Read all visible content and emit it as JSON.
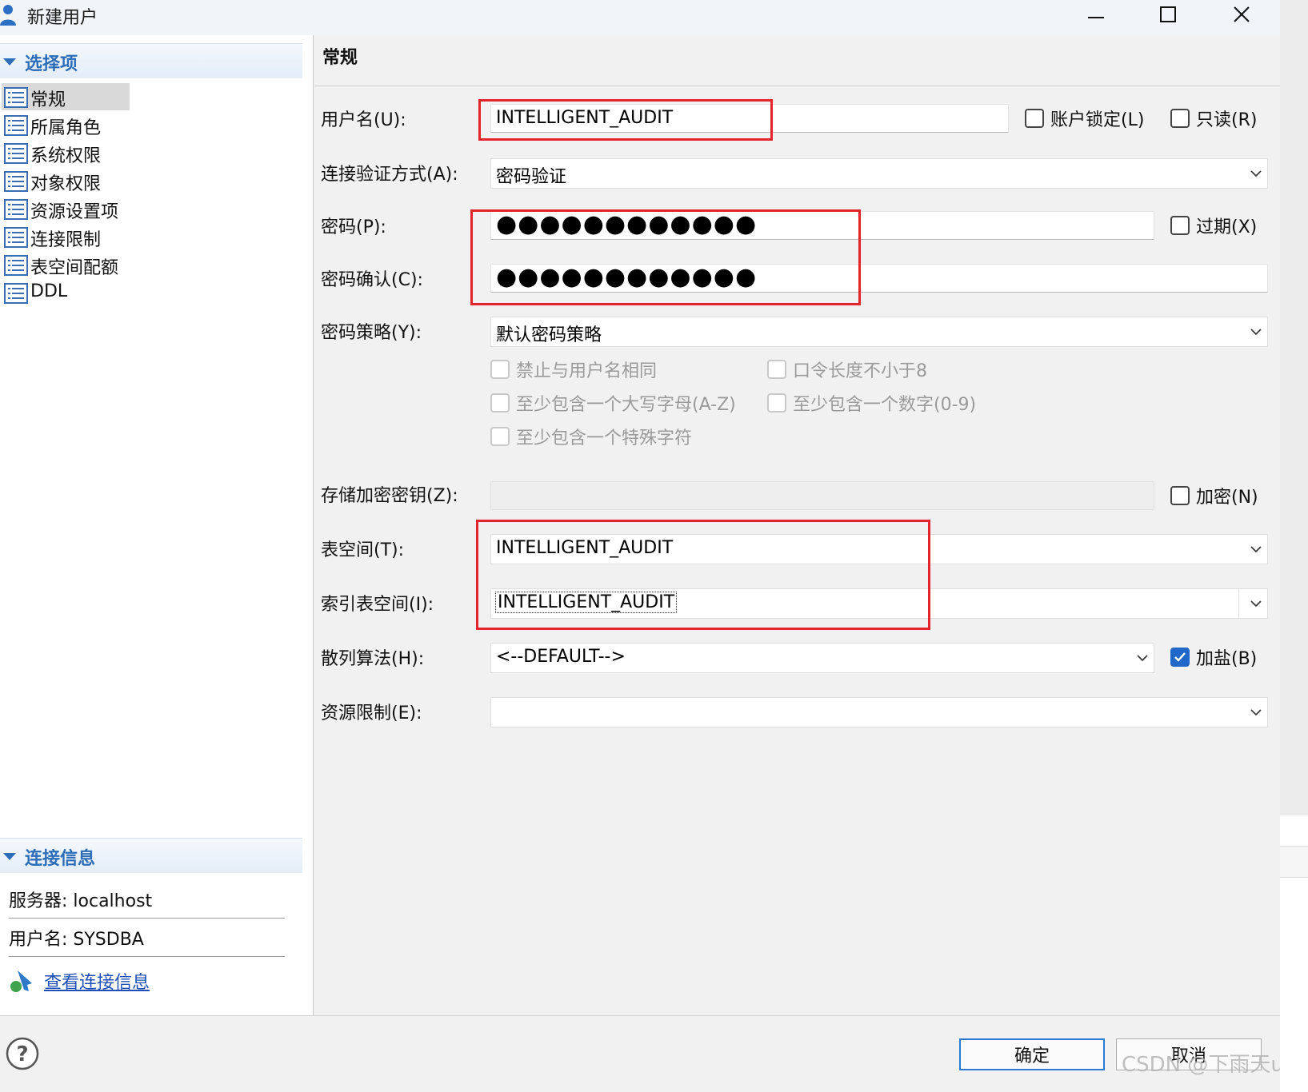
{
  "window": {
    "title": "新建用户"
  },
  "left": {
    "options_header": "选择项",
    "nav_items": [
      "常规",
      "所属角色",
      "系统权限",
      "对象权限",
      "资源设置项",
      "连接限制",
      "表空间配额",
      "DDL"
    ],
    "selected_item": "常规",
    "conn_header": "连接信息",
    "server_line": "服务器: localhost",
    "user_line": "用户名: SYSDBA",
    "view_link": "查看连接信息"
  },
  "content": {
    "section_title": "常规",
    "username_label": "用户名(U):",
    "username_value": "INTELLIGENT_AUDIT",
    "account_locked_label": "账户锁定(L)",
    "readonly_label": "只读(R)",
    "auth_label": "连接验证方式(A):",
    "auth_value": "密码验证",
    "password_label": "密码(P):",
    "password_mask": "●●●●●●●●●●●●",
    "expire_label": "过期(X)",
    "password_confirm_label": "密码确认(C):",
    "password_confirm_mask": "●●●●●●●●●●●●",
    "policy_label": "密码策略(Y):",
    "policy_value": "默认密码策略",
    "policy_options": {
      "not_same_as_username": "禁止与用户名相同",
      "min_length_8": "口令长度不小于8",
      "uppercase": "至少包含一个大写字母(A-Z)",
      "digit": "至少包含一个数字(0-9)",
      "special": "至少包含一个特殊字符"
    },
    "storage_key_label": "存储加密密钥(Z):",
    "storage_key_value": "",
    "encrypt_label": "加密(N)",
    "tablespace_label": "表空间(T):",
    "tablespace_value": "INTELLIGENT_AUDIT",
    "index_tablespace_label": "索引表空间(I):",
    "index_tablespace_value": "INTELLIGENT_AUDIT",
    "hash_label": "散列算法(H):",
    "hash_value": "<--DEFAULT-->",
    "salt_label": "加盐(B)",
    "salt_checked": true,
    "resource_limit_label": "资源限制(E):",
    "resource_limit_value": ""
  },
  "buttons": {
    "ok": "确定",
    "cancel": "取消"
  },
  "watermark": "CSDN @下雨天u",
  "colors": {
    "accent": "#2d6db7",
    "highlight": "#e3242b",
    "link": "#1f4fb4",
    "checkbox_on": "#1f68c9"
  }
}
